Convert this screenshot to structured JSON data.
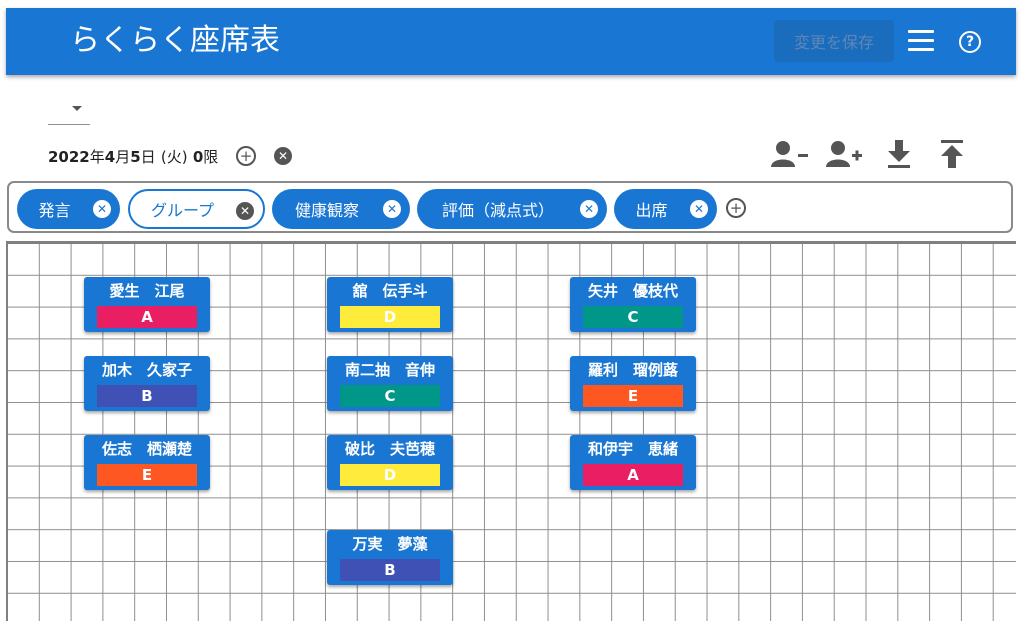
{
  "app": {
    "title": "らくらく座席表",
    "save_label": "変更を保存",
    "menu_icon": "menu-icon",
    "help_icon": "help-icon",
    "primary_color": "#1976d2"
  },
  "session": {
    "date": {
      "year": "2022",
      "year_u": "年",
      "month": "4",
      "month_u": "月",
      "day": "5",
      "day_u": "日",
      "weekday": "(火)",
      "period": "0",
      "period_u": "限"
    }
  },
  "toolbar": {
    "icons": [
      "remove-person-icon",
      "add-person-icon",
      "download-icon",
      "upload-icon"
    ]
  },
  "filters": [
    {
      "label": "発言",
      "style": "filled"
    },
    {
      "label": "グループ",
      "style": "outlined"
    },
    {
      "label": "健康観察",
      "style": "filled"
    },
    {
      "label": "評価（減点式）",
      "style": "filled"
    },
    {
      "label": "出席",
      "style": "filled"
    }
  ],
  "groups": {
    "A": "#e91e63",
    "B": "#3f51b5",
    "C": "#009688",
    "D": "#ffeb3b",
    "E": "#ff5722"
  },
  "students": [
    {
      "name": "愛生　江尾",
      "group": "A"
    },
    {
      "name": "加木　久家子",
      "group": "B"
    },
    {
      "name": "佐志　栖瀬楚",
      "group": "E"
    },
    {
      "name": "舘　伝手斗",
      "group": "D"
    },
    {
      "name": "南二抽　音伸",
      "group": "C"
    },
    {
      "name": "破比　夫芭穂",
      "group": "D"
    },
    {
      "name": "万実　夢藻",
      "group": "B"
    },
    {
      "name": "矢井　優枝代",
      "group": "C"
    },
    {
      "name": "羅利　瑠例蕗",
      "group": "E"
    },
    {
      "name": "和伊宇　恵緒",
      "group": "A"
    }
  ]
}
